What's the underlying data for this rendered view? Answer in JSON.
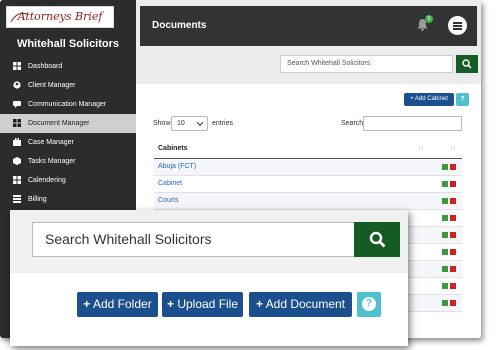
{
  "app": {
    "logo_text": "Attorneys Brief",
    "firm_name": "Whitehall Solicitors"
  },
  "sidebar": {
    "items": [
      {
        "label": "Dashboard",
        "icon": "dashboard-icon",
        "active": false
      },
      {
        "label": "Client Manager",
        "icon": "user-icon",
        "active": false
      },
      {
        "label": "Communication Manager",
        "icon": "chat-icon",
        "active": false
      },
      {
        "label": "Document Manager",
        "icon": "folder-icon",
        "active": true
      },
      {
        "label": "Case Manager",
        "icon": "briefcase-icon",
        "active": false
      },
      {
        "label": "Tasks Manager",
        "icon": "tasks-icon",
        "active": false
      },
      {
        "label": "Calendering",
        "icon": "calendar-icon",
        "active": false
      },
      {
        "label": "Billing",
        "icon": "billing-icon",
        "active": false
      }
    ]
  },
  "header": {
    "title": "Documents",
    "notification_count": "0"
  },
  "search": {
    "placeholder": "Search Whitehall Solicitors"
  },
  "toolbar": {
    "add_cabinet": "Add Cabinet",
    "help": "?"
  },
  "table_controls": {
    "show_label": "Show",
    "page_length": "10",
    "entries_label": "entries",
    "search_label": "Search:"
  },
  "table": {
    "header": "Cabinets",
    "rows": [
      "Abuja (FCT)",
      "Cabinet",
      "Courts",
      "",
      "",
      "",
      "",
      "",
      ""
    ]
  },
  "zoom": {
    "search_placeholder": "Search Whitehall Solicitors",
    "add_folder": "Add Folder",
    "upload_file": "Upload File",
    "add_document": "Add Document"
  },
  "colors": {
    "accent_blue": "#1c4f8d",
    "search_green": "#145c24",
    "help_cyan": "#4fc0d0",
    "sidebar_dark": "#2c2c2c",
    "topbar_dark": "#333333"
  }
}
